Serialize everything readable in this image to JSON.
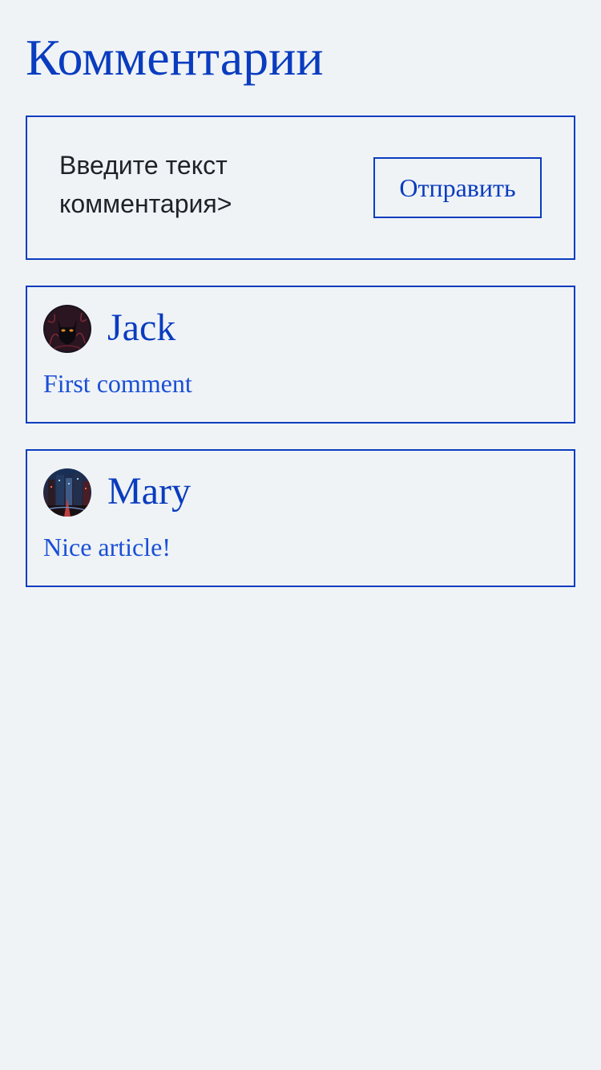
{
  "page": {
    "title": "Комментарии"
  },
  "composer": {
    "input_value": "Введите текст комментария>",
    "send_label": "Отправить"
  },
  "comments": [
    {
      "author": "Jack",
      "text": "First comment",
      "avatar_icon": "black-cat-avatar"
    },
    {
      "author": "Mary",
      "text": "Nice article!",
      "avatar_icon": "night-city-avatar"
    }
  ],
  "colors": {
    "accent": "#0a3cbf",
    "comment_text": "#1a4fd6",
    "background": "#eff3f6"
  }
}
